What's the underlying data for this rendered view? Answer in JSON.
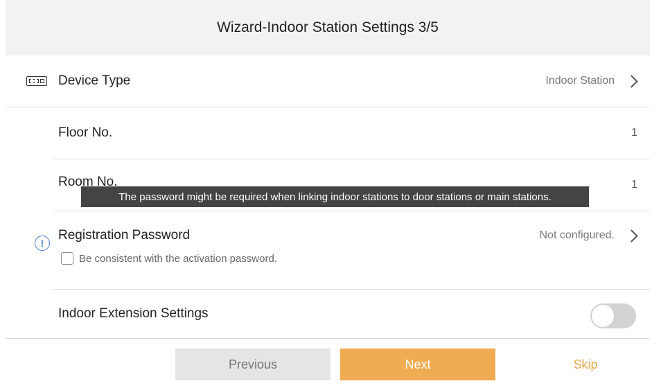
{
  "header": {
    "title": "Wizard-Indoor Station Settings 3/5"
  },
  "rows": {
    "device_type": {
      "icon": "device-icon",
      "label": "Device Type",
      "value": "Indoor Station"
    },
    "floor_no": {
      "label": "Floor No.",
      "value": "1"
    },
    "room_no": {
      "label": "Room No.",
      "value": "1"
    },
    "registration_password": {
      "icon": "info-icon",
      "label": "Registration Password",
      "value": "Not configured.",
      "checkbox_label": "Be consistent with the activation password.",
      "checkbox_checked": false
    },
    "indoor_extension": {
      "label": "Indoor Extension Settings",
      "toggle_on": false
    }
  },
  "tooltip": {
    "text": "The password might be required when linking indoor stations to door stations or main stations."
  },
  "info_glyph": "!",
  "footer": {
    "previous_label": "Previous",
    "next_label": "Next",
    "skip_label": "Skip"
  },
  "colors": {
    "accent": "#f0ac52",
    "info": "#4a7fd6",
    "header_bg": "#f2f2f2"
  }
}
